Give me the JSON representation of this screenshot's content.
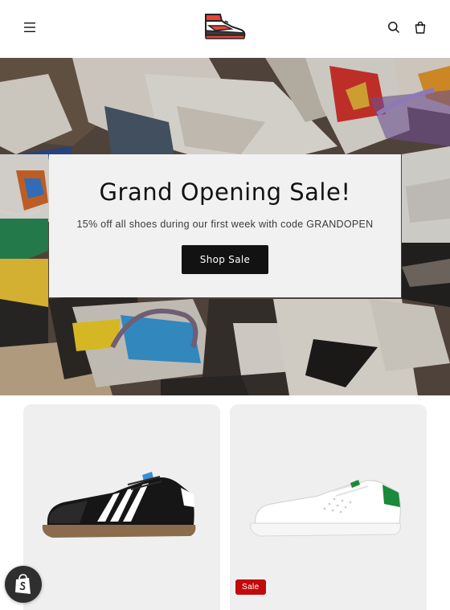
{
  "header": {
    "menu_icon": "hamburger-menu-icon",
    "logo_icon": "sneaker-logo",
    "search_icon": "search-icon",
    "cart_icon": "cart-icon"
  },
  "hero": {
    "title": "Grand Opening Sale!",
    "subtitle": "15% off all shoes during our first week with code GRANDOPEN",
    "cta_label": "Shop Sale"
  },
  "products": [
    {
      "image": "black-white-sneaker",
      "badge": ""
    },
    {
      "image": "white-green-sneaker",
      "badge": "Sale"
    }
  ],
  "shopify": {
    "icon": "shopify-bag-icon"
  },
  "colors": {
    "button": "#121212",
    "sale_badge": "#c20a0a",
    "card_bg": "#efefef",
    "hero_box": "#f1f1f1"
  }
}
